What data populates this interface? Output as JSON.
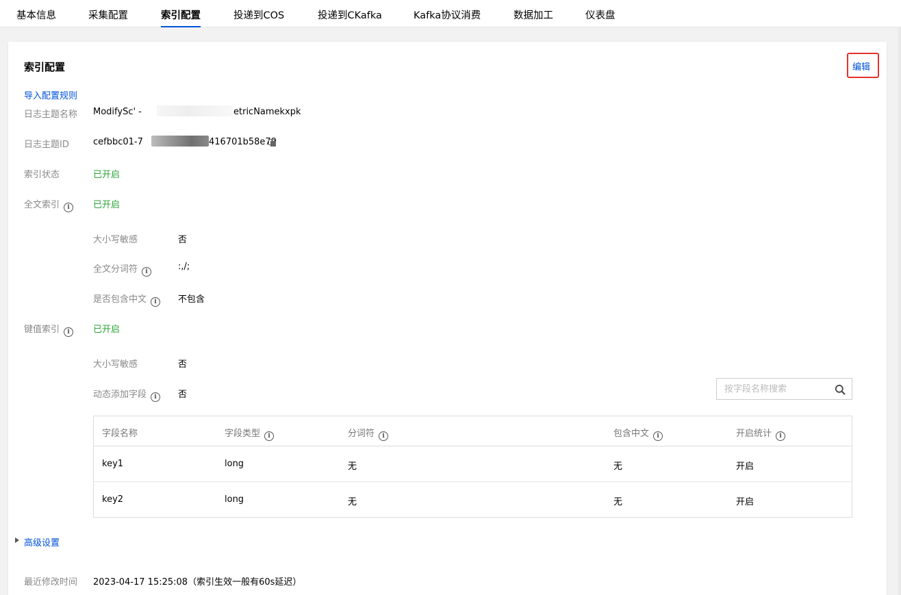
{
  "tabs": [
    {
      "label": "基本信息"
    },
    {
      "label": "采集配置"
    },
    {
      "label": "索引配置"
    },
    {
      "label": "投递到COS"
    },
    {
      "label": "投递到CKafka"
    },
    {
      "label": "Kafka协议消费"
    },
    {
      "label": "数据加工"
    },
    {
      "label": "仪表盘"
    }
  ],
  "active_tab": "索引配置",
  "card": {
    "title": "索引配置",
    "edit_label": "编辑",
    "import_rules_label": "导入配置规则"
  },
  "info": {
    "topic_name_label": "日志主题名称",
    "topic_name_prefix": "ModifySc'  -",
    "topic_name_suffix": "etricNamekxpk",
    "topic_id_label": "日志主题ID",
    "topic_id_prefix": "cefbbc01-7",
    "topic_id_suffix": "416701b58e79",
    "index_status_label": "索引状态",
    "index_status_value": "已开启",
    "fulltext_label": "全文索引",
    "fulltext_value": "已开启",
    "case_sensitive_label": "大小写敏感",
    "case_sensitive_value": "否",
    "tokenizer_label": "全文分词符",
    "tokenizer_value": ":,/;",
    "include_chinese_label": "是否包含中文",
    "include_chinese_value": "不包含",
    "kv_index_label": "键值索引",
    "kv_index_value": "已开启",
    "kv_case_sensitive_label": "大小写敏感",
    "kv_case_sensitive_value": "否",
    "dynamic_fields_label": "动态添加字段",
    "dynamic_fields_value": "否"
  },
  "search": {
    "placeholder": "按字段名称搜索"
  },
  "table": {
    "columns": [
      "字段名称",
      "字段类型",
      "分词符",
      "包含中文",
      "开启统计"
    ],
    "rows": [
      [
        "key1",
        "long",
        "无",
        "无",
        "开启"
      ],
      [
        "key2",
        "long",
        "无",
        "无",
        "开启"
      ]
    ]
  },
  "advanced_label": "高级设置",
  "footer": {
    "last_modified_label": "最近修改时间",
    "last_modified_value": "2023-04-17 15:25:08（索引生效一般有60s延迟）"
  },
  "colors": {
    "link": "#0052d9",
    "enabled": "#29a338",
    "highlight_border": "#e5312a"
  },
  "icons": [
    "info-icon",
    "copy-icon",
    "search-icon",
    "caret-right-icon"
  ]
}
